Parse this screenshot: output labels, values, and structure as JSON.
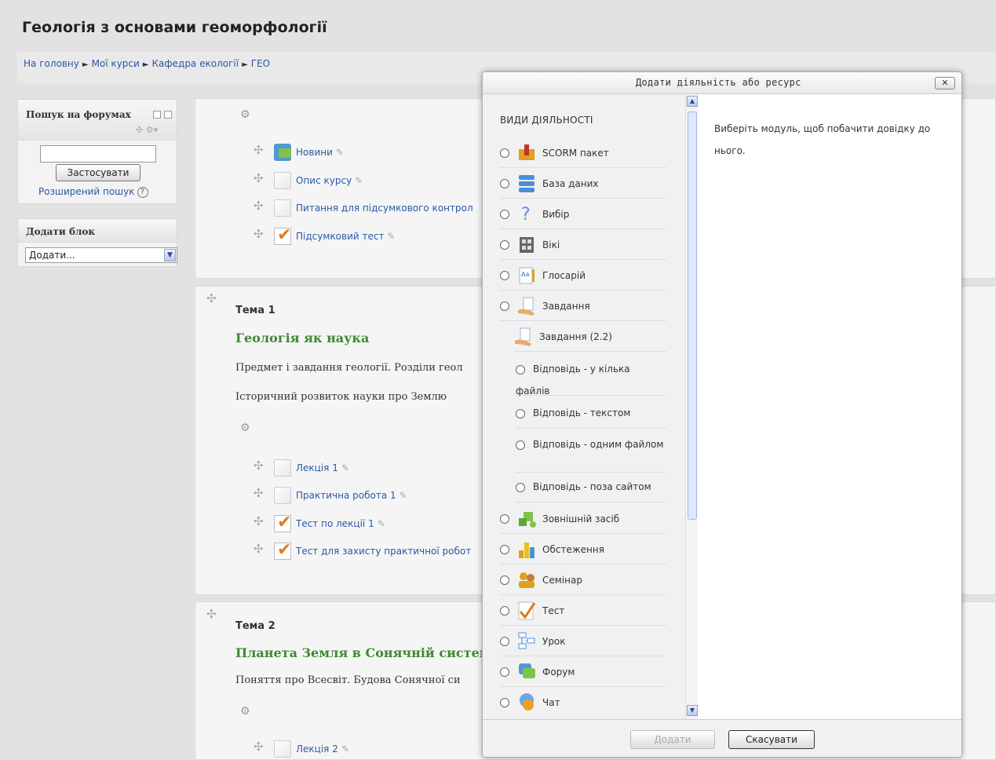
{
  "page": {
    "title": "Геологія з основами геоморфології"
  },
  "breadcrumb": [
    {
      "label": "На головну"
    },
    {
      "label": "Мої курси"
    },
    {
      "label": "Кафедра екології"
    },
    {
      "label": "ГЕО"
    }
  ],
  "breadcrumb_sep": "►",
  "forum_search": {
    "title": "Пошук на форумах",
    "input_value": "",
    "apply_label": "Застосувати",
    "advanced_label": "Розширений пошук",
    "help_glyph": "?"
  },
  "add_block": {
    "title": "Додати блок",
    "select_value": "Додати..."
  },
  "section0": {
    "activities": [
      {
        "label": "Новини",
        "icon": "forum-icon"
      },
      {
        "label": "Опис курсу",
        "icon": "page-icon"
      },
      {
        "label": "Питання для підсумкового контрол",
        "icon": "page-icon"
      },
      {
        "label": "Підсумковий тест",
        "icon": "quiz-icon"
      }
    ]
  },
  "section1": {
    "title": "Тема 1",
    "heading": "Геологія як наука",
    "text1": "Предмет і завдання геології. Розділи геол",
    "text2": "Історичний розвиток науки про Землю",
    "activities": [
      {
        "label": "Лекція 1"
      },
      {
        "label": "Практична робота 1"
      },
      {
        "label": "Тест по лекції 1"
      },
      {
        "label": "Тест для захисту практичної робот"
      }
    ]
  },
  "section2": {
    "title": "Тема 2",
    "heading": "Планета Земля в Сонячній систем",
    "text1": "Поняття про Всесвіт. Будова Сонячної си",
    "activities": [
      {
        "label": "Лекція 2"
      }
    ]
  },
  "modal": {
    "title": "Додати діяльність або ресурс",
    "close_label": "✕",
    "category": "ВИДИ ДІЯЛЬНОСТІ",
    "help_text": "Виберіть модуль, щоб побачити довідку до нього.",
    "options": [
      {
        "label": "SCORM пакет",
        "icon": "scorm-icon"
      },
      {
        "label": "База даних",
        "icon": "database-icon"
      },
      {
        "label": "Вибір",
        "icon": "choice-icon"
      },
      {
        "label": "Вікі",
        "icon": "wiki-icon"
      },
      {
        "label": "Глосарій",
        "icon": "glossary-icon"
      },
      {
        "label": "Завдання",
        "icon": "assignment-icon"
      }
    ],
    "assignment22": {
      "label": "Завдання (2.2)",
      "suboptions": [
        {
          "label": "Відповідь - у кілька файлів"
        },
        {
          "label": "Відповідь - текстом"
        },
        {
          "label": "Відповідь - одним файлом"
        },
        {
          "label": "Відповідь - поза сайтом"
        }
      ]
    },
    "options2": [
      {
        "label": "Зовнішній засіб",
        "icon": "external-tool-icon"
      },
      {
        "label": "Обстеження",
        "icon": "survey-icon"
      },
      {
        "label": "Семінар",
        "icon": "workshop-icon"
      },
      {
        "label": "Тест",
        "icon": "quiz-icon"
      },
      {
        "label": "Урок",
        "icon": "lesson-icon"
      },
      {
        "label": "Форум",
        "icon": "forum-icon"
      },
      {
        "label": "Чат",
        "icon": "chat-icon"
      }
    ],
    "add_label": "Додати",
    "cancel_label": "Скасувати"
  }
}
